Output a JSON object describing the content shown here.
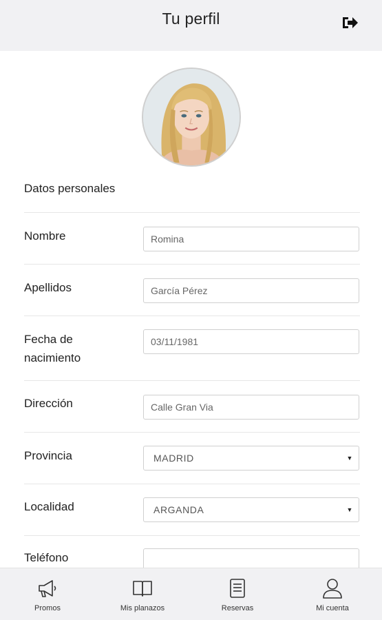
{
  "header": {
    "title": "Tu perfil"
  },
  "profile": {
    "section_title": "Datos personales"
  },
  "form": {
    "nombre": {
      "label": "Nombre",
      "value": "Romina"
    },
    "apellidos": {
      "label": "Apellidos",
      "value": "García Pérez"
    },
    "fecha": {
      "label_line1": "Fecha de",
      "label_line2": "nacimiento",
      "value": "03/11/1981"
    },
    "direccion": {
      "label": "Dirección",
      "value": "Calle Gran Via"
    },
    "provincia": {
      "label": "Provincia",
      "selected": "MADRID"
    },
    "localidad": {
      "label": "Localidad",
      "selected": "ARGANDA"
    },
    "telefono": {
      "label": "Teléfono",
      "value": ""
    }
  },
  "bottom_nav": {
    "items": [
      {
        "label": "Promos",
        "icon": "megaphone-icon"
      },
      {
        "label": "Mis planazos",
        "icon": "book-icon"
      },
      {
        "label": "Reservas",
        "icon": "document-icon"
      },
      {
        "label": "Mi cuenta",
        "icon": "user-icon"
      }
    ]
  },
  "icons": {
    "logout": "logout-icon",
    "caret": "▼"
  }
}
